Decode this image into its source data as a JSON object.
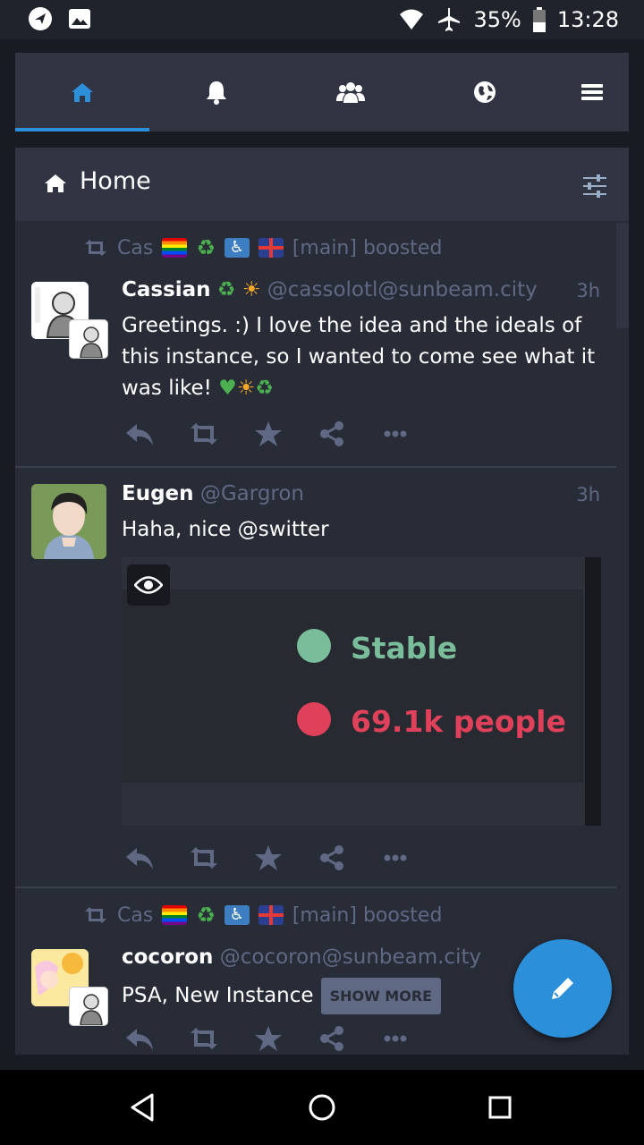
{
  "status_bar": {
    "battery": "35%",
    "time": "13:28"
  },
  "tabs": [
    {
      "name": "home",
      "icon": "home-icon",
      "active": true
    },
    {
      "name": "notifications",
      "icon": "bell-icon"
    },
    {
      "name": "local",
      "icon": "users-icon"
    },
    {
      "name": "federated",
      "icon": "globe-icon"
    },
    {
      "name": "menu",
      "icon": "hamburger-icon"
    }
  ],
  "column": {
    "title": "Home",
    "settings_icon": "sliders-icon"
  },
  "posts": [
    {
      "boost": {
        "by": "Cas",
        "suffix": "[main] boosted"
      },
      "display_name": "Cassian",
      "acct": "@cassolotl@sunbeam.city",
      "time": "3h",
      "content": "Greetings. :) I love the idea and the ideals of this instance, so I wanted to come see what it was like!"
    },
    {
      "display_name": "Eugen",
      "acct": "@Gargron",
      "time": "3h",
      "content": "Haha, nice @switter",
      "media": {
        "legend": [
          {
            "label": "Stable",
            "color": "#79bd9a"
          },
          {
            "label": "69.1k people",
            "color": "#df405a"
          }
        ]
      }
    },
    {
      "boost": {
        "by": "Cas",
        "suffix": "[main] boosted"
      },
      "display_name": "cocoron",
      "acct": "@cocoron@sunbeam.city",
      "content": "PSA, New Instance",
      "show_more": "SHOW MORE"
    }
  ],
  "colors": {
    "accent": "#2b90d9",
    "muted": "#606984",
    "panel": "#282c37",
    "header": "#313543"
  }
}
